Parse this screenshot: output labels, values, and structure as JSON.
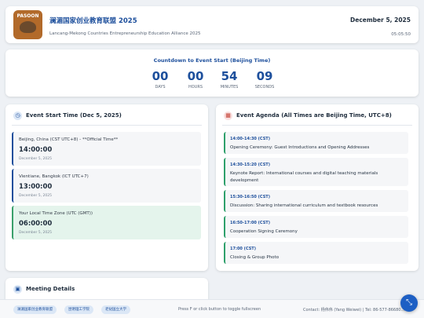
{
  "header": {
    "logo_text": "PASOON",
    "title": "澜湄国家创业教育联盟 2025",
    "subtitle": "Lancang-Mekong Countries Entrepreneurship Education Alliance 2025",
    "date": "December 5, 2025",
    "clock": "05:05:50"
  },
  "countdown": {
    "title": "Countdown to Event Start (Beijing Time)",
    "units": [
      {
        "value": "00",
        "label": "DAYS"
      },
      {
        "value": "00",
        "label": "HOURS"
      },
      {
        "value": "54",
        "label": "MINUTES"
      },
      {
        "value": "09",
        "label": "SECONDS"
      }
    ]
  },
  "event_start": {
    "title": "Event Start Time (Dec 5, 2025)",
    "icon": "clock-icon",
    "zones": [
      {
        "label": "Beijing, China (CST UTC+8) - **Official Time**",
        "time": "14:00:00",
        "date": "December 5, 2025"
      },
      {
        "label": "Vientiane, Bangkok (ICT UTC+7)",
        "time": "13:00:00",
        "date": "December 5, 2025"
      },
      {
        "label": "Your Local Time Zone (UTC (GMT))",
        "time": "06:00:00",
        "date": "December 5, 2025"
      }
    ]
  },
  "agenda": {
    "title": "Event Agenda (All Times are Beijing Time, UTC+8)",
    "icon": "calendar-icon",
    "items": [
      {
        "time": "14:00-14:30 (CST)",
        "desc": "Opening Ceremony: Guest Introductions and Opening Addresses"
      },
      {
        "time": "14:30-15:20 (CST)",
        "desc": "Keynote Report: International courses and digital teaching materials development"
      },
      {
        "time": "15:30-16:50 (CST)",
        "desc": "Discussion: Sharing international curriculum and textbook resources"
      },
      {
        "time": "16:50-17:00 (CST)",
        "desc": "Cooperation Signing Ceremony"
      },
      {
        "time": "17:00 (CST)",
        "desc": "Closing & Group Photo"
      }
    ]
  },
  "meeting": {
    "title": "Meeting Details",
    "icon": "laptop-icon"
  },
  "footer": {
    "pills": [
      "澜湄国家创业教育联盟",
      "昆明理工学院",
      "老挝国立大学"
    ],
    "hint": "Press F or click button to toggle fullscreen",
    "contact": "Contact: 杨伟伟 (Yang Weiwei) | Tel: 86-577-86680..."
  },
  "colors": {
    "accent": "#1d4f9c",
    "agenda_border": "#2ea06b",
    "local_bg": "#e4f4ec",
    "fab": "#1d5fc4"
  }
}
